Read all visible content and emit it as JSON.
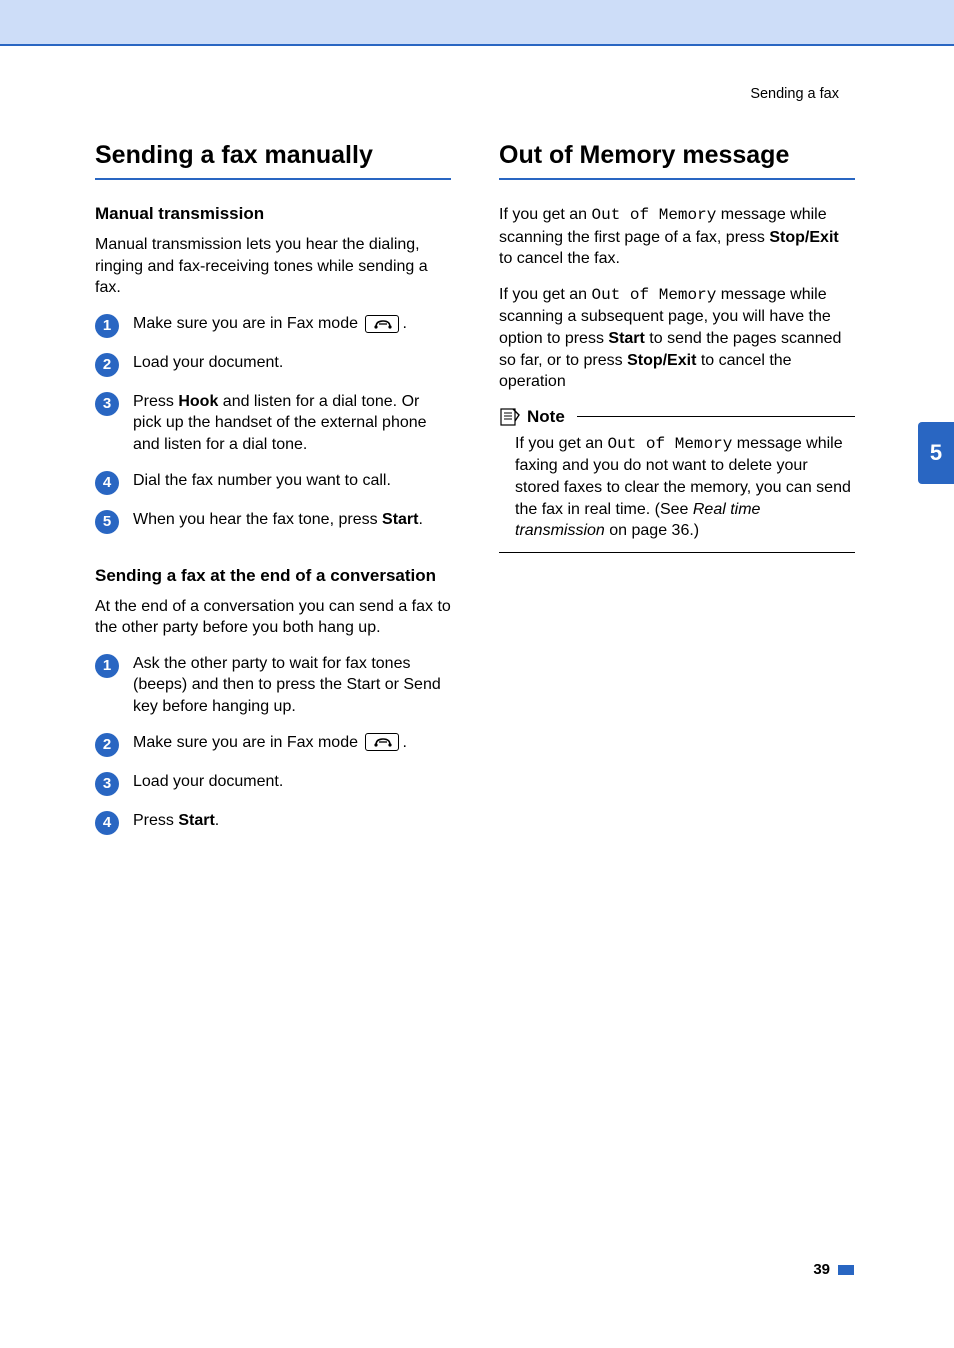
{
  "header": {
    "breadcrumb": "Sending a fax"
  },
  "side_tab": "5",
  "left": {
    "h1": "Sending a fax manually",
    "sec1": {
      "h2": "Manual transmission",
      "intro": "Manual transmission lets you hear the dialing, ringing and fax-receiving tones while sending a fax.",
      "steps": {
        "s1a": "Make sure you are in Fax mode ",
        "s1b": ".",
        "s2": "Load your document.",
        "s3a": "Press ",
        "s3b": "Hook",
        "s3c": " and listen for a dial tone. Or pick up the handset of the external phone and listen for a dial tone.",
        "s4": "Dial the fax number you want to call.",
        "s5a": "When you hear the fax tone, press ",
        "s5b": "Start",
        "s5c": "."
      }
    },
    "sec2": {
      "h2": "Sending a fax at the end of a conversation",
      "intro": "At the end of a conversation you can send a fax to the other party before you both hang up.",
      "steps": {
        "s1": "Ask the other party to wait for fax tones (beeps) and then to press the Start or Send key before hanging up.",
        "s2a": "Make sure you are in Fax mode ",
        "s2b": ".",
        "s3": "Load your document.",
        "s4a": "Press ",
        "s4b": "Start",
        "s4c": "."
      }
    }
  },
  "right": {
    "h1": "Out of Memory message",
    "p1a": "If you get an ",
    "p1b": "Out of Memory",
    "p1c": " message while scanning the first page of a fax, press ",
    "p1d": "Stop/Exit",
    "p1e": " to cancel the fax.",
    "p2a": " If you get an ",
    "p2b": "Out of Memory",
    "p2c": " message while scanning a subsequent page, you will have the option to press ",
    "p2d": "Start",
    "p2e": " to send the pages scanned so far, or to press ",
    "p2f": "Stop/Exit",
    "p2g": " to cancel the operation",
    "note": {
      "title": "Note",
      "b1": "If you get an ",
      "b2": "Out of Memory",
      "b3": " message while faxing and you do not want to delete your stored faxes to clear the memory, you can send the fax in real time. (See ",
      "b4": "Real time transmission",
      "b5": " on page 36.)"
    }
  },
  "footer": {
    "page": "39"
  }
}
